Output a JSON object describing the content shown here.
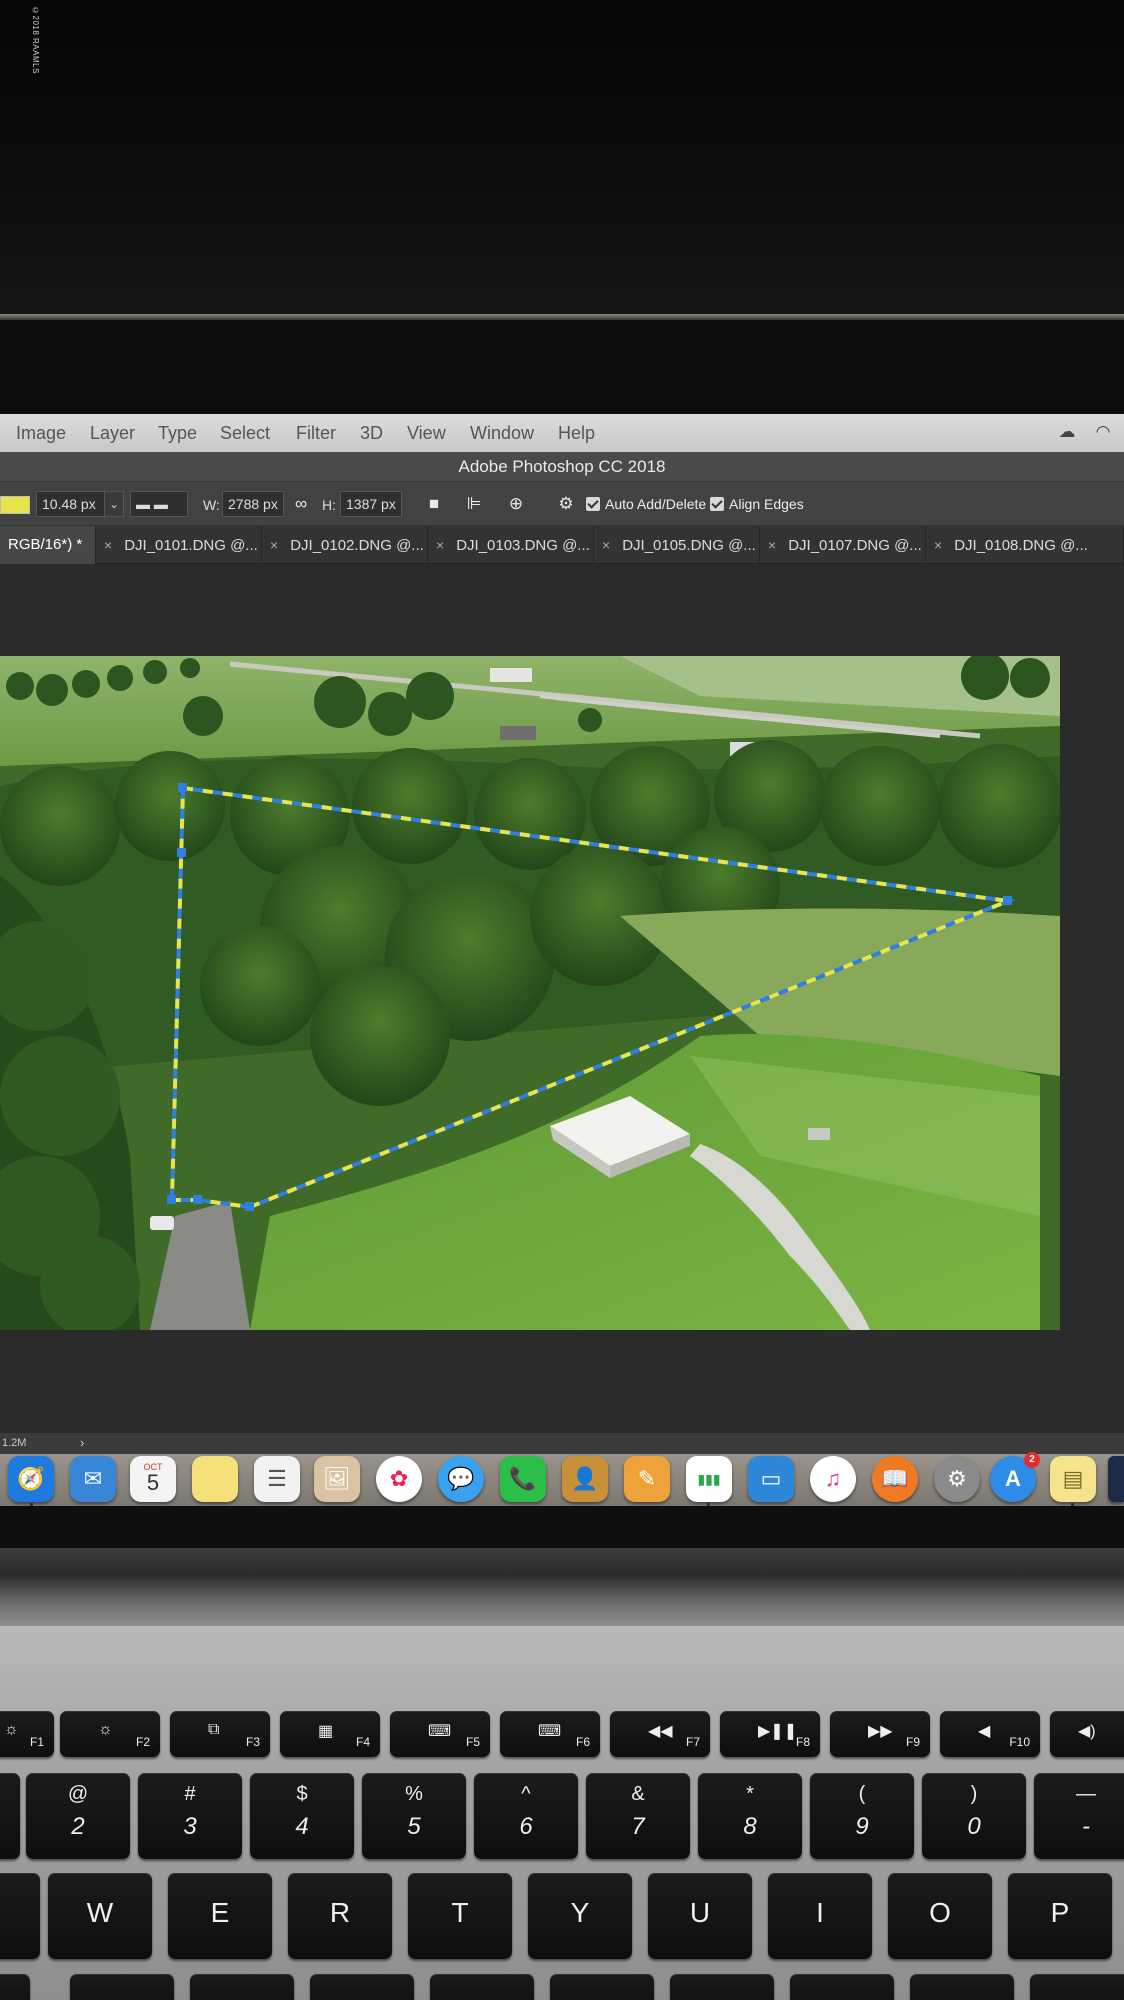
{
  "watermark": "©2018 RAAMLS",
  "menubar": {
    "items": [
      "Image",
      "Layer",
      "Type",
      "Select",
      "Filter",
      "3D",
      "View",
      "Window",
      "Help"
    ],
    "status_icons": [
      "creative-cloud-icon",
      "wifi-icon"
    ]
  },
  "app_title": "Adobe Photoshop CC 2018",
  "options_bar": {
    "stroke_width": "10.48 px",
    "width_label": "W:",
    "width_value": "2788 px",
    "height_label": "H:",
    "height_value": "1387 px",
    "auto_add_delete_label": "Auto Add/Delete",
    "auto_add_delete_checked": true,
    "align_edges_label": "Align Edges",
    "align_edges_checked": true,
    "swatch_color": "#e7e44a"
  },
  "tabs": [
    {
      "label": "RGB/16*) *",
      "active": true
    },
    {
      "label": "DJI_0101.DNG @...",
      "active": false
    },
    {
      "label": "DJI_0102.DNG @...",
      "active": false
    },
    {
      "label": "DJI_0103.DNG @...",
      "active": false
    },
    {
      "label": "DJI_0105.DNG @...",
      "active": false
    },
    {
      "label": "DJI_0107.DNG @...",
      "active": false
    },
    {
      "label": "DJI_0108.DNG @...",
      "active": false
    }
  ],
  "tab_close_glyph": "×",
  "status_bar": {
    "doc_size": "1.2M",
    "arrow": "›"
  },
  "selection_colors": {
    "dash_a": "#2f7fe0",
    "dash_b": "#e8e44a"
  },
  "dock": {
    "apps": [
      {
        "name": "safari-icon",
        "glyph": "🧭",
        "color": "#1f7ae0"
      },
      {
        "name": "mail-icon",
        "glyph": "✉",
        "color": "#3a86d6"
      },
      {
        "name": "calendar-icon",
        "glyph": "5",
        "color": "#f4f4f4",
        "month": "OCT"
      },
      {
        "name": "notes-icon",
        "glyph": "",
        "color": "#f5e07a"
      },
      {
        "name": "reminders-icon",
        "glyph": "☰",
        "color": "#f2f2f2"
      },
      {
        "name": "preview-icon",
        "glyph": "🖼",
        "color": "#d9c3a0"
      },
      {
        "name": "photos-icon",
        "glyph": "✿",
        "color": "#ffffff"
      },
      {
        "name": "messages-icon",
        "glyph": "💬",
        "color": "#3aa1f0"
      },
      {
        "name": "facetime-icon",
        "glyph": "📞",
        "color": "#2bbf4a"
      },
      {
        "name": "contacts-icon",
        "glyph": "👤",
        "color": "#c9903a"
      },
      {
        "name": "pages-icon",
        "glyph": "✎",
        "color": "#f0a23a"
      },
      {
        "name": "numbers-icon",
        "glyph": "▮▮▮",
        "color": "#ffffff"
      },
      {
        "name": "keynote-icon",
        "glyph": "▭",
        "color": "#2d87d8"
      },
      {
        "name": "itunes-icon",
        "glyph": "♫",
        "color": "#ffffff"
      },
      {
        "name": "ibooks-icon",
        "glyph": "📖",
        "color": "#f07a21"
      },
      {
        "name": "system-preferences-icon",
        "glyph": "⚙",
        "color": "#8a8a8a"
      },
      {
        "name": "app-store-icon",
        "glyph": "A",
        "color": "#2e8ce8",
        "badge": "2"
      },
      {
        "name": "stickies-icon",
        "glyph": "▤",
        "color": "#f5e48c"
      },
      {
        "name": "finder-window-icon",
        "glyph": "",
        "color": "#1d2b48"
      }
    ]
  },
  "keyboard": {
    "function_keys": [
      {
        "glyph": "☼",
        "label": "F1"
      },
      {
        "glyph": "☼",
        "label": "F2"
      },
      {
        "glyph": "⧉",
        "label": "F3"
      },
      {
        "glyph": "▦",
        "label": "F4"
      },
      {
        "glyph": "⌨",
        "label": "F5"
      },
      {
        "glyph": "⌨",
        "label": "F6"
      },
      {
        "glyph": "◀◀",
        "label": "F7"
      },
      {
        "glyph": "▶❚❚",
        "label": "F8"
      },
      {
        "glyph": "▶▶",
        "label": "F9"
      },
      {
        "glyph": "◀",
        "label": "F10"
      },
      {
        "glyph": "◀)",
        "label": ""
      }
    ],
    "number_keys": [
      {
        "top": "@",
        "bottom": "2"
      },
      {
        "top": "#",
        "bottom": "3"
      },
      {
        "top": "$",
        "bottom": "4"
      },
      {
        "top": "%",
        "bottom": "5"
      },
      {
        "top": "^",
        "bottom": "6"
      },
      {
        "top": "&",
        "bottom": "7"
      },
      {
        "top": "*",
        "bottom": "8"
      },
      {
        "top": "(",
        "bottom": "9"
      },
      {
        "top": ")",
        "bottom": "0"
      },
      {
        "top": "—",
        "bottom": "-"
      }
    ],
    "letter_keys": [
      "W",
      "E",
      "R",
      "T",
      "Y",
      "U",
      "I",
      "O",
      "P"
    ]
  }
}
